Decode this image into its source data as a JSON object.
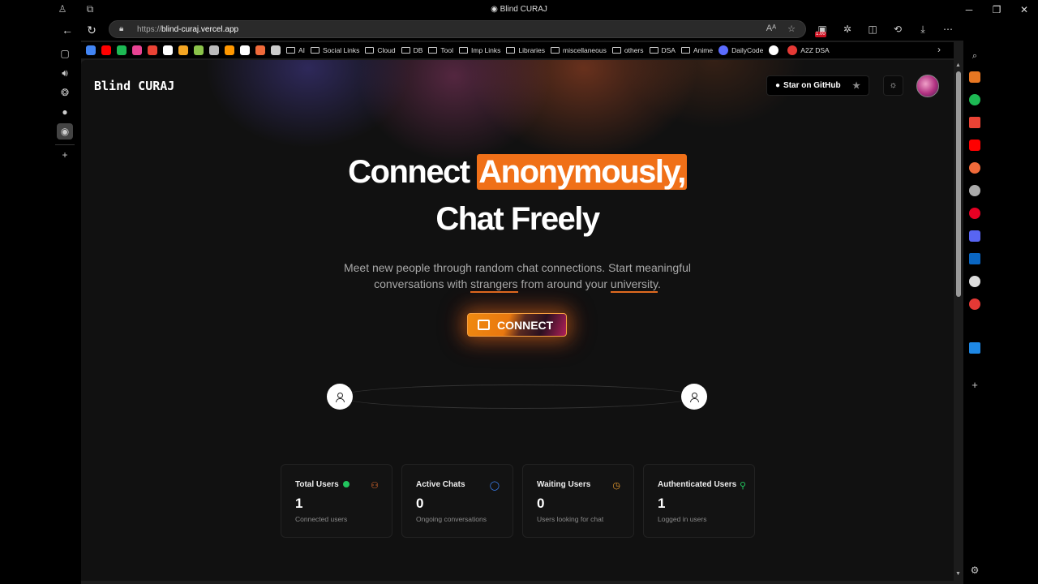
{
  "window": {
    "title": "Blind CURAJ"
  },
  "address_bar": {
    "scheme": "https://",
    "host": "blind-curaj.vercel.app"
  },
  "toolbar": {
    "extension_badge": "1.00"
  },
  "bookmarks": [
    {
      "label": "",
      "color": "#4285f4"
    },
    {
      "label": "",
      "color": "#ff0000"
    },
    {
      "label": "",
      "color": "#1db954"
    },
    {
      "label": "",
      "color": "#e84393"
    },
    {
      "label": "",
      "color": "#ea4335"
    },
    {
      "label": "",
      "color": "#ffffff"
    },
    {
      "label": "",
      "color": "#f5a623"
    },
    {
      "label": "",
      "color": "#8bc34a"
    },
    {
      "label": "",
      "color": "#bbbbbb"
    },
    {
      "label": "",
      "color": "#ff9800"
    },
    {
      "label": "",
      "color": "#ffffff"
    },
    {
      "label": "",
      "color": "#f06a3a"
    },
    {
      "label": "",
      "color": "#cccccc"
    }
  ],
  "bookmark_folders": [
    "AI",
    "Social Links",
    "Cloud",
    "DB",
    "Tool",
    "Imp Links",
    "Libraries",
    "miscellaneous",
    "others",
    "DSA",
    "Anime"
  ],
  "bookmark_sites": [
    {
      "label": "DailyCode",
      "color": "#5b6cff"
    },
    {
      "label": "",
      "color": "#ffffff"
    },
    {
      "label": "A2Z DSA",
      "color": "#e53935"
    }
  ],
  "page": {
    "brand": "Blind CURAJ",
    "github_button": "Star on GitHub",
    "hero_line1_pre": "Connect ",
    "hero_line1_highlight": "Anonymously,",
    "hero_line2": "Chat Freely",
    "subtitle_part1": "Meet new people through random chat connections. Start meaningful",
    "subtitle_part2": "conversations with ",
    "subtitle_word1": "strangers",
    "subtitle_part3": " from around your ",
    "subtitle_word2": "university",
    "subtitle_part4": ".",
    "connect_button": "CONNECT",
    "accent_color": "#f07018"
  },
  "stats": [
    {
      "title": "Total Users",
      "value": "1",
      "description": "Connected users",
      "icon": "users-icon",
      "icon_color": "#f07030"
    },
    {
      "title": "Active Chats",
      "value": "0",
      "description": "Ongoing conversations",
      "icon": "chat-bubble-icon",
      "icon_color": "#3b82f6"
    },
    {
      "title": "Waiting Users",
      "value": "0",
      "description": "Users looking for chat",
      "icon": "clock-icon",
      "icon_color": "#f0a030"
    },
    {
      "title": "Authenticated Users",
      "value": "1",
      "description": "Logged in users",
      "icon": "user-check-icon",
      "icon_color": "#22c55e"
    }
  ]
}
